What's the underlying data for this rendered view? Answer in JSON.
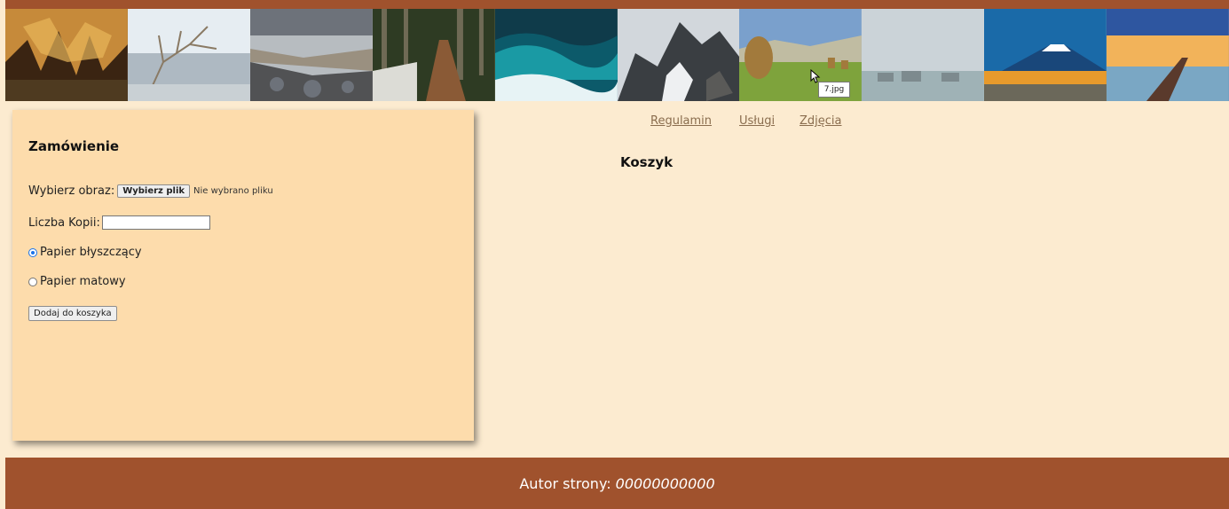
{
  "banner": {
    "images": [
      {
        "name": "cave",
        "colors": [
          "#3a2412",
          "#c68a3a",
          "#e8b65a",
          "#4e3a20"
        ]
      },
      {
        "name": "winter-tree-lake",
        "colors": [
          "#e6edf2",
          "#aeb9c2",
          "#c9d0d4",
          "#8a7a64"
        ]
      },
      {
        "name": "rocky-shore",
        "colors": [
          "#b7bcc0",
          "#6d727a",
          "#515254",
          "#9a9080"
        ]
      },
      {
        "name": "forest-boardwalk",
        "colors": [
          "#2e3b23",
          "#6f6a55",
          "#dcdcd6",
          "#8a5a36"
        ]
      },
      {
        "name": "ocean-waves",
        "colors": [
          "#0f3b4a",
          "#1a9aa4",
          "#e7f3f5",
          "#0c5a6a"
        ]
      },
      {
        "name": "mountain-peaks",
        "colors": [
          "#d2d7dc",
          "#3a3e42",
          "#eef0f2",
          "#5a5a58"
        ]
      },
      {
        "name": "haystack-meadow",
        "colors": [
          "#7aa0cc",
          "#c0bca2",
          "#a27a3c",
          "#7ea33c"
        ]
      },
      {
        "name": "overwater-huts",
        "colors": [
          "#cbd3d8",
          "#aab3b8",
          "#7d8a8e",
          "#9fb2b6"
        ]
      },
      {
        "name": "mount-fuji",
        "colors": [
          "#1a6aa8",
          "#ffffff",
          "#e79a2c",
          "#19477a"
        ]
      },
      {
        "name": "pier-sunset",
        "colors": [
          "#2e56a0",
          "#f2b35a",
          "#5a3a2c",
          "#7aa7c4"
        ]
      }
    ],
    "tooltip": "7.jpg"
  },
  "order": {
    "title": "Zamówienie",
    "image_label": "Wybierz obraz:",
    "file_button": "Wybierz plik",
    "file_status": "Nie wybrano pliku",
    "copies_label": "Liczba Kopii:",
    "copies_value": "",
    "paper_glossy": "Papier błyszczący",
    "paper_matte": "Papier matowy",
    "paper_selected": "glossy",
    "add_button": "Dodaj do koszyka"
  },
  "nav": {
    "items": [
      "Regulamin",
      "Usługi",
      "Zdjęcia"
    ]
  },
  "cart": {
    "title": "Koszyk"
  },
  "footer": {
    "label": "Autor strony:",
    "author": "00000000000"
  },
  "colors": {
    "page_background": "#fcebd0",
    "panel_background": "#fddcac",
    "brand_brown": "#a0522d",
    "link": "#8a6d4e"
  }
}
